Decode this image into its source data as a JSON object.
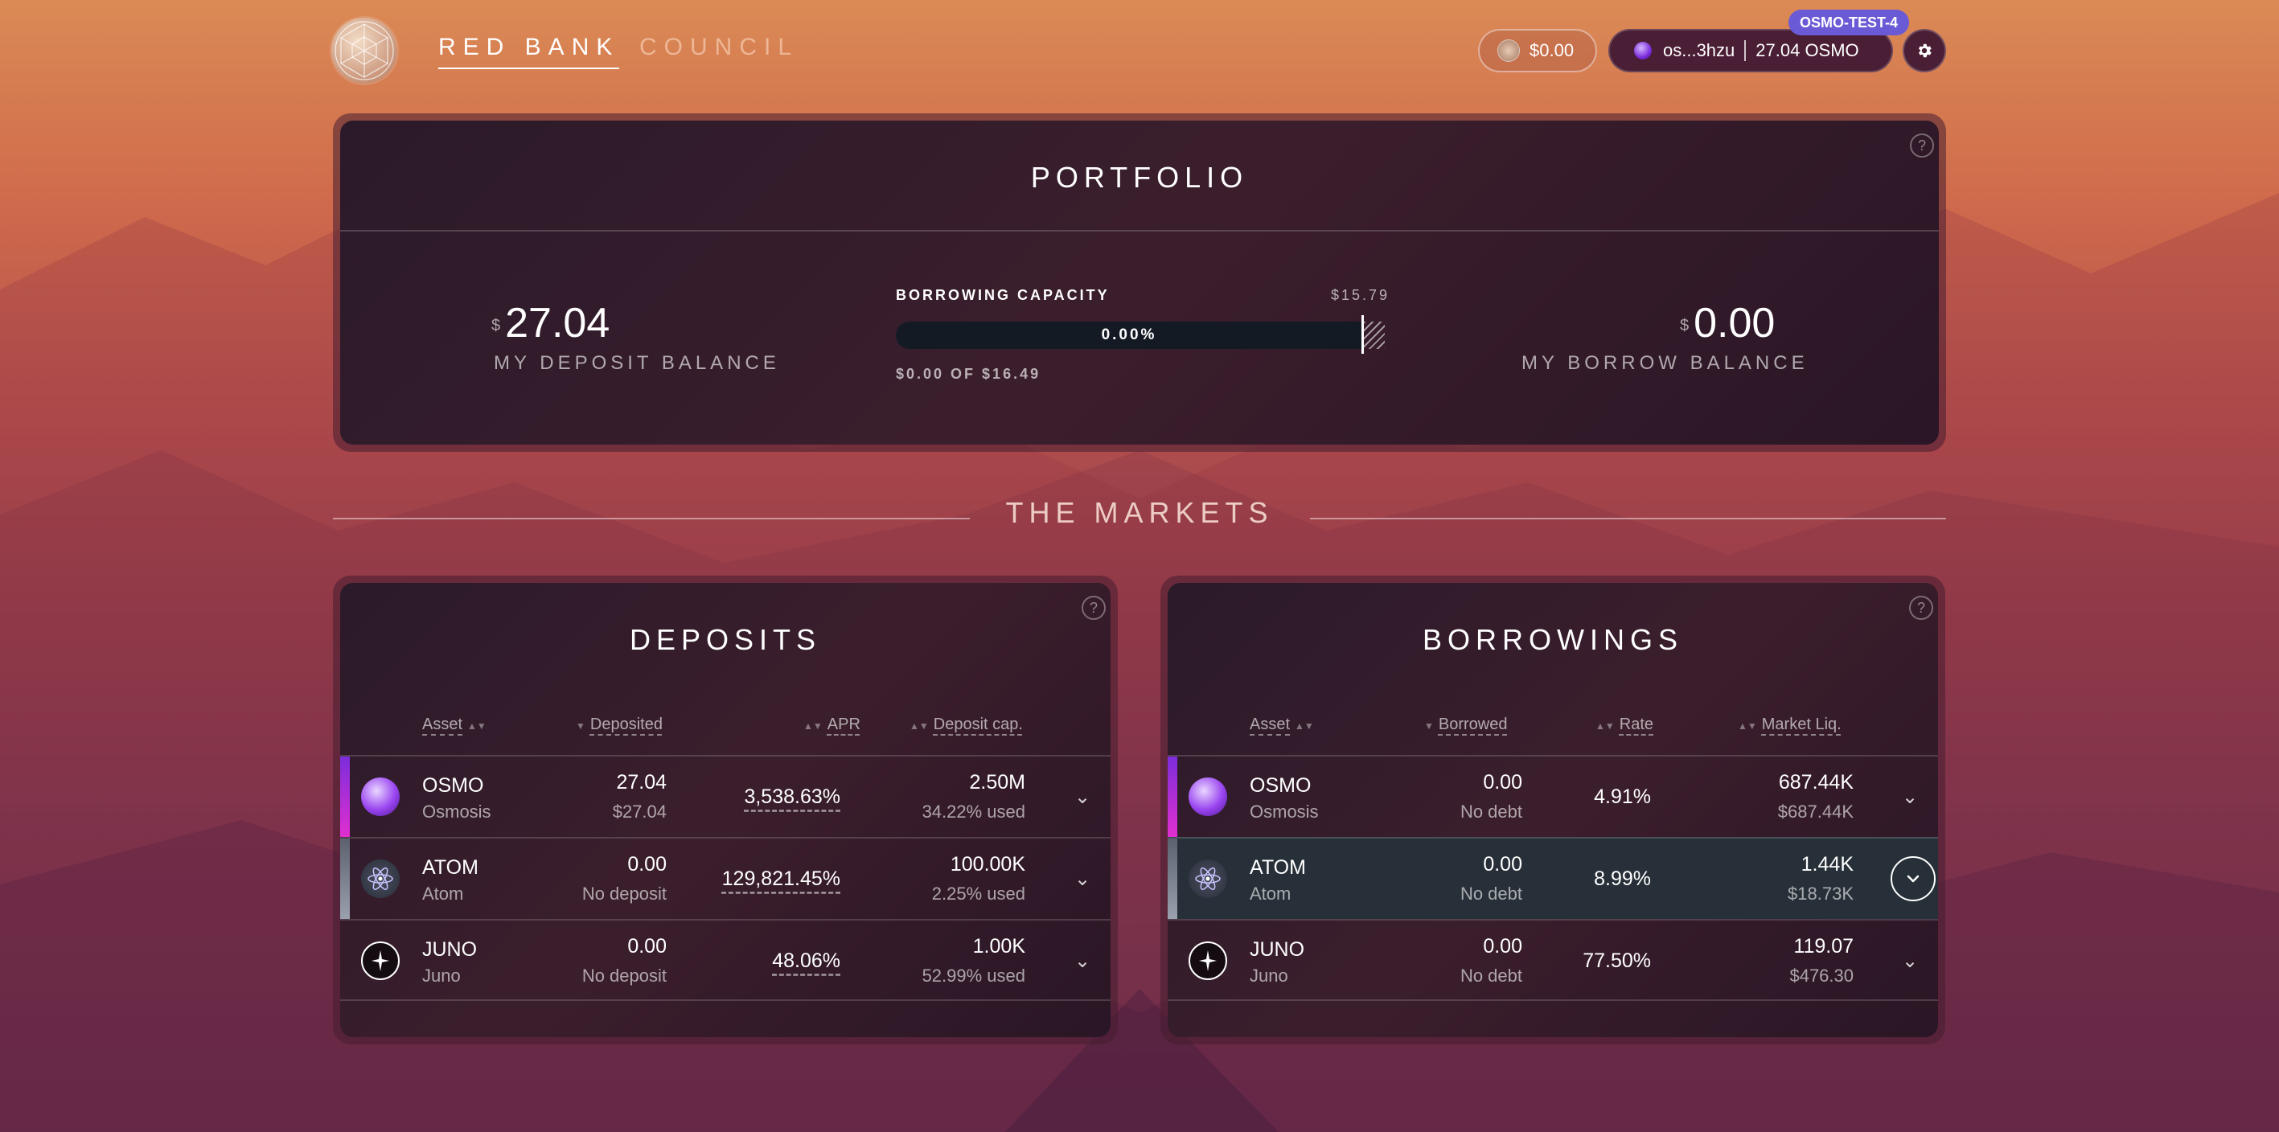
{
  "header": {
    "nav": {
      "red_bank": "RED BANK",
      "council": "COUNCIL"
    },
    "balance_pill": {
      "value": "$0.00"
    },
    "wallet": {
      "address": "os...3hzu",
      "balance": "27.04 OSMO"
    },
    "network_badge": "OSMO-TEST-4"
  },
  "portfolio": {
    "title": "PORTFOLIO",
    "deposit": {
      "currency": "$",
      "amount": "27.04",
      "label": "MY DEPOSIT BALANCE"
    },
    "borrow": {
      "currency": "$",
      "amount": "0.00",
      "label": "MY BORROW BALANCE"
    },
    "borrowing_capacity": {
      "title": "BORROWING CAPACITY",
      "limit": "$15.79",
      "percent": "0.00%",
      "fill_fraction": 0,
      "used": "$0.00 OF $16.49"
    }
  },
  "markets_title": "THE MARKETS",
  "deposits": {
    "title": "DEPOSITS",
    "columns": {
      "asset": "Asset",
      "amount": "Deposited",
      "rate": "APR",
      "cap": "Deposit cap."
    },
    "rows": [
      {
        "symbol": "OSMO",
        "name": "Osmosis",
        "amount": "27.04",
        "amount_sub": "$27.04",
        "rate": "3,538.63%",
        "cap": "2.50M",
        "cap_sub": "34.22% used"
      },
      {
        "symbol": "ATOM",
        "name": "Atom",
        "amount": "0.00",
        "amount_sub": "No deposit",
        "rate": "129,821.45%",
        "cap": "100.00K",
        "cap_sub": "2.25% used"
      },
      {
        "symbol": "JUNO",
        "name": "Juno",
        "amount": "0.00",
        "amount_sub": "No deposit",
        "rate": "48.06%",
        "cap": "1.00K",
        "cap_sub": "52.99% used"
      }
    ]
  },
  "borrowings": {
    "title": "BORROWINGS",
    "columns": {
      "asset": "Asset",
      "amount": "Borrowed",
      "rate": "Rate",
      "liq": "Market Liq."
    },
    "rows": [
      {
        "symbol": "OSMO",
        "name": "Osmosis",
        "amount": "0.00",
        "amount_sub": "No debt",
        "rate": "4.91%",
        "liq": "687.44K",
        "liq_sub": "$687.44K"
      },
      {
        "symbol": "ATOM",
        "name": "Atom",
        "amount": "0.00",
        "amount_sub": "No debt",
        "rate": "8.99%",
        "liq": "1.44K",
        "liq_sub": "$18.73K"
      },
      {
        "symbol": "JUNO",
        "name": "Juno",
        "amount": "0.00",
        "amount_sub": "No debt",
        "rate": "77.50%",
        "liq": "119.07",
        "liq_sub": "$476.30"
      }
    ]
  },
  "colors": {
    "osmo_accent": "#a626e0",
    "atom_accent": "#7a7f8c",
    "network_badge": "#6a5ad6",
    "highlight_row": "#273038"
  },
  "icons": {
    "logo": "mars-geodesic-logo",
    "settings": "gear-icon",
    "help": "question-circle-icon",
    "expand": "chevron-down-icon"
  }
}
